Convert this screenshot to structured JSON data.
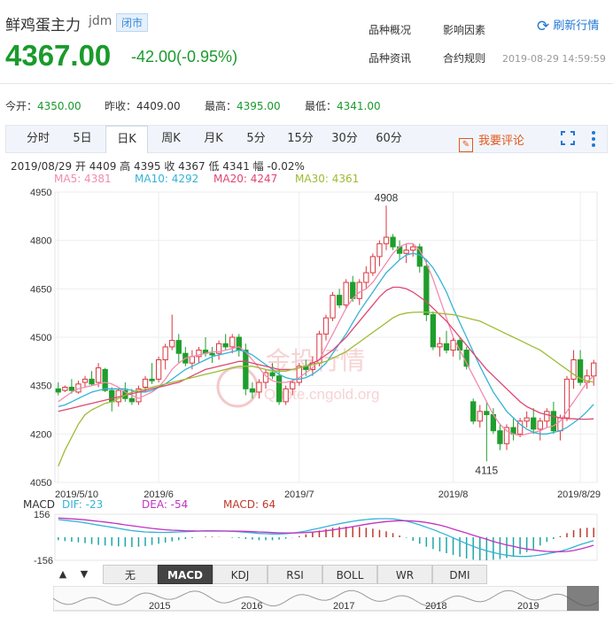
{
  "header": {
    "name": "鲜鸡蛋主力",
    "code": "jdm",
    "status_badge": "闭市",
    "price": "4367.00",
    "change": "-42.00(-0.95%)",
    "links": [
      "品种概况",
      "影响因素",
      "品种资讯",
      "合约规则"
    ],
    "refresh_label": "刷新行情",
    "timestamp": "2019-08-29 14:59:59"
  },
  "stats": {
    "open_label": "今开：",
    "open": "4350.00",
    "prev_label": "昨收：",
    "prev": "4409.00",
    "high_label": "最高：",
    "high": "4395.00",
    "low_label": "最低：",
    "low": "4341.00"
  },
  "tabs": [
    "分时",
    "5日",
    "日K",
    "周K",
    "月K",
    "5分",
    "15分",
    "30分",
    "60分"
  ],
  "active_tab": "日K",
  "comment_label": "我要评论",
  "info_line": "2019/08/29  开 4409  高 4395  收 4367  低 4341  幅 -0.02%",
  "ma_labels": [
    {
      "text": "MA5: 4381",
      "color": "#f28bb0"
    },
    {
      "text": "MA10: 4292",
      "color": "#34b3d6"
    },
    {
      "text": "MA20: 4247",
      "color": "#e04672"
    },
    {
      "text": "MA30: 4361",
      "color": "#9cbb33"
    }
  ],
  "watermark": {
    "main": "金投行情",
    "sub": "Quote.cngold.org"
  },
  "macd_labels": [
    {
      "text": "MACD",
      "color": "#333333"
    },
    {
      "text": "DIF: -23",
      "color": "#34b3d6"
    },
    {
      "text": "DEA: -54",
      "color": "#c233c2"
    },
    {
      "text": "MACD: 64",
      "color": "#c0392b"
    }
  ],
  "indicator_tabs": [
    "无",
    "MACD",
    "KDJ",
    "RSI",
    "BOLL",
    "WR",
    "DMI"
  ],
  "active_indicator": "MACD",
  "overview_years": [
    "2015",
    "2016",
    "2017",
    "2018",
    "2019"
  ],
  "chart_data": {
    "type": "candlestick",
    "ylim": [
      4050,
      4950
    ],
    "y_ticks": [
      "4950",
      "4800",
      "4650",
      "4500",
      "4350",
      "4200",
      "4050"
    ],
    "x_ticks": [
      {
        "label": "2019/5/10",
        "index": 0
      },
      {
        "label": "2019/6",
        "index": 15
      },
      {
        "label": "2019/7",
        "index": 36
      },
      {
        "label": "2019/8",
        "index": 59
      },
      {
        "label": "2019/8/29",
        "index": 78
      }
    ],
    "annotations": [
      {
        "label": "4908",
        "index": 49,
        "value": 4908
      },
      {
        "label": "4115",
        "index": 64,
        "value": 4115
      }
    ],
    "ohlc": [
      [
        4340,
        4360,
        4320,
        4330
      ],
      [
        4335,
        4350,
        4330,
        4345
      ],
      [
        4345,
        4370,
        4325,
        4335
      ],
      [
        4330,
        4365,
        4325,
        4355
      ],
      [
        4360,
        4380,
        4345,
        4370
      ],
      [
        4370,
        4395,
        4350,
        4355
      ],
      [
        4360,
        4420,
        4345,
        4405
      ],
      [
        4400,
        4405,
        4330,
        4335
      ],
      [
        4335,
        4345,
        4270,
        4300
      ],
      [
        4300,
        4340,
        4285,
        4335
      ],
      [
        4335,
        4360,
        4300,
        4310
      ],
      [
        4310,
        4340,
        4290,
        4300
      ],
      [
        4300,
        4350,
        4290,
        4340
      ],
      [
        4345,
        4380,
        4330,
        4370
      ],
      [
        4370,
        4420,
        4355,
        4365
      ],
      [
        4370,
        4440,
        4360,
        4430
      ],
      [
        4430,
        4480,
        4400,
        4470
      ],
      [
        4470,
        4570,
        4460,
        4490
      ],
      [
        4490,
        4510,
        4420,
        4450
      ],
      [
        4450,
        4470,
        4410,
        4420
      ],
      [
        4420,
        4460,
        4400,
        4440
      ],
      [
        4440,
        4470,
        4420,
        4460
      ],
      [
        4460,
        4500,
        4440,
        4450
      ],
      [
        4450,
        4470,
        4420,
        4445
      ],
      [
        4450,
        4490,
        4430,
        4480
      ],
      [
        4480,
        4510,
        4460,
        4470
      ],
      [
        4470,
        4510,
        4450,
        4500
      ],
      [
        4500,
        4510,
        4440,
        4460
      ],
      [
        4460,
        4480,
        4320,
        4340
      ],
      [
        4340,
        4360,
        4310,
        4330
      ],
      [
        4330,
        4370,
        4310,
        4360
      ],
      [
        4360,
        4400,
        4340,
        4390
      ],
      [
        4390,
        4420,
        4370,
        4380
      ],
      [
        4380,
        4400,
        4290,
        4300
      ],
      [
        4300,
        4350,
        4290,
        4340
      ],
      [
        4340,
        4370,
        4320,
        4360
      ],
      [
        4360,
        4420,
        4350,
        4410
      ],
      [
        4410,
        4430,
        4380,
        4400
      ],
      [
        4400,
        4440,
        4380,
        4420
      ],
      [
        4420,
        4520,
        4410,
        4510
      ],
      [
        4510,
        4570,
        4490,
        4560
      ],
      [
        4560,
        4640,
        4550,
        4630
      ],
      [
        4630,
        4650,
        4590,
        4600
      ],
      [
        4600,
        4680,
        4590,
        4670
      ],
      [
        4670,
        4690,
        4610,
        4620
      ],
      [
        4620,
        4680,
        4600,
        4670
      ],
      [
        4670,
        4720,
        4650,
        4700
      ],
      [
        4700,
        4760,
        4690,
        4750
      ],
      [
        4750,
        4800,
        4720,
        4790
      ],
      [
        4790,
        4908,
        4770,
        4810
      ],
      [
        4810,
        4820,
        4770,
        4780
      ],
      [
        4780,
        4800,
        4740,
        4760
      ],
      [
        4760,
        4790,
        4730,
        4770
      ],
      [
        4770,
        4790,
        4750,
        4780
      ],
      [
        4780,
        4790,
        4700,
        4720
      ],
      [
        4720,
        4740,
        4550,
        4570
      ],
      [
        4570,
        4580,
        4460,
        4470
      ],
      [
        4470,
        4500,
        4440,
        4480
      ],
      [
        4480,
        4520,
        4450,
        4460
      ],
      [
        4460,
        4500,
        4440,
        4490
      ],
      [
        4490,
        4500,
        4430,
        4460
      ],
      [
        4460,
        4470,
        4400,
        4410
      ],
      [
        4300,
        4310,
        4230,
        4240
      ],
      [
        4240,
        4290,
        4220,
        4270
      ],
      [
        4270,
        4300,
        4115,
        4260
      ],
      [
        4260,
        4280,
        4200,
        4210
      ],
      [
        4210,
        4230,
        4150,
        4170
      ],
      [
        4170,
        4230,
        4150,
        4220
      ],
      [
        4220,
        4250,
        4180,
        4200
      ],
      [
        4200,
        4250,
        4190,
        4240
      ],
      [
        4240,
        4270,
        4220,
        4250
      ],
      [
        4250,
        4280,
        4200,
        4215
      ],
      [
        4215,
        4250,
        4180,
        4240
      ],
      [
        4240,
        4280,
        4220,
        4270
      ],
      [
        4270,
        4300,
        4200,
        4210
      ],
      [
        4210,
        4260,
        4180,
        4250
      ],
      [
        4250,
        4380,
        4240,
        4370
      ],
      [
        4370,
        4460,
        4340,
        4430
      ],
      [
        4430,
        4460,
        4350,
        4360
      ],
      [
        4360,
        4400,
        4340,
        4380
      ],
      [
        4380,
        4430,
        4350,
        4420
      ]
    ],
    "ma5": [
      4300,
      4315,
      4330,
      4340,
      4345,
      4350,
      4355,
      4360,
      4355,
      4345,
      4330,
      4320,
      4310,
      4320,
      4330,
      4345,
      4370,
      4400,
      4420,
      4435,
      4440,
      4445,
      4450,
      4455,
      4455,
      4460,
      4465,
      4470,
      4455,
      4430,
      4405,
      4380,
      4365,
      4360,
      4360,
      4365,
      4375,
      4390,
      4405,
      4430,
      4470,
      4510,
      4550,
      4590,
      4620,
      4640,
      4650,
      4670,
      4700,
      4730,
      4760,
      4780,
      4790,
      4790,
      4770,
      4730,
      4680,
      4620,
      4560,
      4500,
      4460,
      4420,
      4380,
      4340,
      4300,
      4260,
      4230,
      4210,
      4200,
      4195,
      4200,
      4205,
      4210,
      4220,
      4225,
      4240,
      4270,
      4300,
      4330,
      4360,
      4381
    ],
    "ma10": [
      4285,
      4290,
      4300,
      4310,
      4320,
      4330,
      4335,
      4340,
      4340,
      4340,
      4340,
      4335,
      4330,
      4330,
      4335,
      4345,
      4355,
      4370,
      4385,
      4400,
      4410,
      4420,
      4430,
      4440,
      4445,
      4450,
      4455,
      4460,
      4455,
      4445,
      4430,
      4415,
      4400,
      4385,
      4375,
      4370,
      4370,
      4375,
      4385,
      4400,
      4420,
      4450,
      4480,
      4510,
      4545,
      4580,
      4610,
      4640,
      4670,
      4700,
      4720,
      4740,
      4755,
      4760,
      4755,
      4740,
      4715,
      4680,
      4640,
      4590,
      4545,
      4500,
      4455,
      4410,
      4370,
      4330,
      4300,
      4270,
      4250,
      4230,
      4215,
      4205,
      4200,
      4200,
      4205,
      4210,
      4220,
      4235,
      4250,
      4270,
      4292
    ],
    "ma20": [
      4270,
      4275,
      4280,
      4285,
      4290,
      4295,
      4300,
      4305,
      4310,
      4315,
      4320,
      4325,
      4330,
      4335,
      4340,
      4345,
      4350,
      4355,
      4360,
      4370,
      4380,
      4390,
      4400,
      4405,
      4410,
      4415,
      4420,
      4425,
      4425,
      4420,
      4415,
      4410,
      4405,
      4400,
      4400,
      4400,
      4405,
      4410,
      4420,
      4430,
      4445,
      4460,
      4480,
      4500,
      4525,
      4550,
      4575,
      4600,
      4625,
      4645,
      4655,
      4655,
      4650,
      4640,
      4625,
      4610,
      4590,
      4570,
      4550,
      4525,
      4500,
      4475,
      4450,
      4425,
      4400,
      4380,
      4360,
      4340,
      4320,
      4300,
      4285,
      4275,
      4265,
      4260,
      4255,
      4250,
      4248,
      4247,
      4246,
      4246,
      4247
    ],
    "ma30": [
      4100,
      4150,
      4190,
      4230,
      4260,
      4275,
      4285,
      4295,
      4300,
      4310,
      4320,
      4330,
      4335,
      4340,
      4345,
      4350,
      4355,
      4360,
      4365,
      4370,
      4375,
      4380,
      4385,
      4390,
      4395,
      4400,
      4405,
      4410,
      4410,
      4410,
      4405,
      4400,
      4395,
      4395,
      4395,
      4400,
      4405,
      4410,
      4415,
      4420,
      4425,
      4435,
      4445,
      4455,
      4470,
      4485,
      4500,
      4515,
      4530,
      4545,
      4560,
      4570,
      4575,
      4577,
      4578,
      4578,
      4576,
      4574,
      4572,
      4570,
      4565,
      4560,
      4555,
      4550,
      4540,
      4530,
      4520,
      4510,
      4500,
      4490,
      4480,
      4470,
      4460,
      4445,
      4430,
      4415,
      4400,
      4385,
      4372,
      4365,
      4361
    ],
    "macd_ylim": [
      -156,
      156
    ],
    "macd_ticks": [
      "156",
      "-156"
    ],
    "dif": [
      120,
      115,
      110,
      105,
      98,
      90,
      82,
      75,
      68,
      60,
      52,
      45,
      40,
      36,
      34,
      33,
      33,
      34,
      36,
      38,
      40,
      42,
      44,
      44,
      43,
      42,
      40,
      38,
      34,
      30,
      26,
      24,
      22,
      22,
      24,
      28,
      34,
      42,
      52,
      62,
      72,
      82,
      92,
      100,
      108,
      115,
      120,
      124,
      126,
      126,
      124,
      118,
      110,
      98,
      84,
      68,
      52,
      34,
      16,
      -4,
      -24,
      -44,
      -62,
      -78,
      -92,
      -104,
      -114,
      -122,
      -128,
      -130,
      -130,
      -126,
      -120,
      -112,
      -104,
      -94,
      -82,
      -66,
      -50,
      -36,
      -23
    ],
    "dea": [
      130,
      128,
      125,
      122,
      118,
      113,
      108,
      103,
      97,
      91,
      84,
      78,
      72,
      66,
      60,
      55,
      51,
      48,
      46,
      44,
      43,
      42,
      42,
      42,
      42,
      42,
      42,
      41,
      40,
      38,
      36,
      34,
      32,
      30,
      29,
      29,
      30,
      32,
      35,
      39,
      44,
      50,
      57,
      64,
      72,
      80,
      88,
      95,
      101,
      106,
      110,
      112,
      112,
      110,
      106,
      100,
      92,
      82,
      70,
      56,
      42,
      28,
      14,
      0,
      -14,
      -28,
      -40,
      -52,
      -62,
      -72,
      -80,
      -86,
      -92,
      -96,
      -98,
      -98,
      -96,
      -90,
      -80,
      -68,
      -54
    ],
    "macd": [
      -20,
      -26,
      -30,
      -34,
      -40,
      -46,
      -52,
      -56,
      -58,
      -62,
      -64,
      -66,
      -64,
      -60,
      -52,
      -44,
      -36,
      -28,
      -20,
      -12,
      -6,
      0,
      4,
      4,
      2,
      0,
      -4,
      -6,
      -12,
      -16,
      -20,
      -20,
      -20,
      -16,
      -10,
      -2,
      8,
      20,
      34,
      46,
      56,
      64,
      70,
      72,
      72,
      70,
      64,
      58,
      50,
      40,
      28,
      12,
      -4,
      -24,
      -44,
      -64,
      -80,
      -96,
      -108,
      -120,
      -132,
      -144,
      -152,
      -156,
      -156,
      -152,
      -148,
      -140,
      -132,
      -116,
      -100,
      -80,
      -56,
      -32,
      -12,
      8,
      28,
      48,
      60,
      64,
      64
    ]
  }
}
